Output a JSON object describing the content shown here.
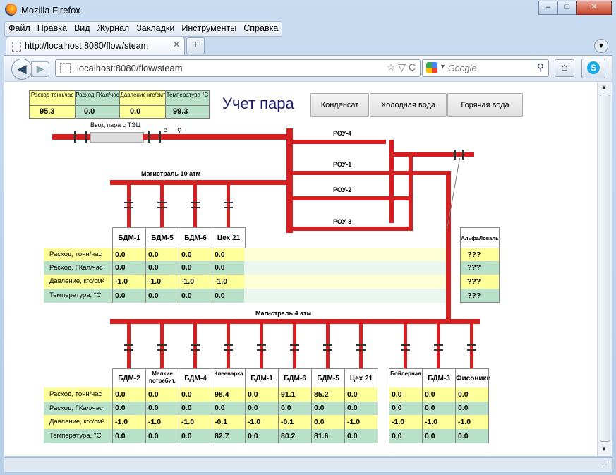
{
  "window": {
    "title": "Mozilla Firefox",
    "min": "–",
    "max": "□",
    "close": "✕"
  },
  "menu": [
    "Файл",
    "Правка",
    "Вид",
    "Журнал",
    "Закладки",
    "Инструменты",
    "Справка"
  ],
  "tab": {
    "title": "http://localhost:8080/flow/steam",
    "close": "✕",
    "new": "+"
  },
  "nav": {
    "back": "◀",
    "forward": "▶",
    "url": "localhost:8080/flow/steam",
    "search_placeholder": "Google",
    "home": "⌂",
    "url_icons": "☆ ▽ C",
    "search_icon": "⚲"
  },
  "page": {
    "title": "Учет пара",
    "buttons": [
      "Конденсат",
      "Холодная вода",
      "Горячая вода"
    ],
    "summary": {
      "headers": [
        "Расход тонн/час",
        "Расход ГКал/час",
        "Давление кгс/см²",
        "Температура °С"
      ],
      "values": [
        "95.3",
        "0.0",
        "0.0",
        "99.3"
      ]
    },
    "labels": {
      "inlet": "Ввод пара с ТЭЦ",
      "main10": "Магистраль 10 атм",
      "main4": "Магистраль 4 атм",
      "rou4": "РОУ-4",
      "rou1": "РОУ-1",
      "rou2": "РОУ-2",
      "rou3": "РОУ-3",
      "alfa": "АльфаЛоваль"
    },
    "row_labels": [
      "Расход, тонн/час",
      "Расход, ГКал/час",
      "Давление, кгс/см²",
      "Температура, °С"
    ],
    "top_consumers": [
      {
        "name": "БДМ-1",
        "values": [
          "0.0",
          "0.0",
          "-1.0",
          "0.0"
        ]
      },
      {
        "name": "БДМ-5",
        "values": [
          "0.0",
          "0.0",
          "-1.0",
          "0.0"
        ]
      },
      {
        "name": "БДМ-6",
        "values": [
          "0.0",
          "0.0",
          "-1.0",
          "0.0"
        ]
      },
      {
        "name": "Цех 21",
        "values": [
          "0.0",
          "0.0",
          "-1.0",
          "0.0"
        ]
      }
    ],
    "alfa_values": [
      "???",
      "???",
      "???",
      "???"
    ],
    "bottom_consumers": [
      {
        "name": "БДМ-2",
        "values": [
          "0.0",
          "0.0",
          "-1.0",
          "0.0"
        ]
      },
      {
        "name": "Мелкие потребит.",
        "values": [
          "0.0",
          "0.0",
          "-1.0",
          "0.0"
        ]
      },
      {
        "name": "БДМ-4",
        "values": [
          "0.0",
          "0.0",
          "-1.0",
          "0.0"
        ]
      },
      {
        "name": "Клееварка",
        "values": [
          "98.4",
          "0.0",
          "-0.1",
          "82.7"
        ]
      },
      {
        "name": "БДМ-1",
        "values": [
          "0.0",
          "0.0",
          "-1.0",
          "0.0"
        ]
      },
      {
        "name": "БДМ-6",
        "values": [
          "91.1",
          "0.0",
          "-0.1",
          "80.2"
        ]
      },
      {
        "name": "БДМ-5",
        "values": [
          "85.2",
          "0.0",
          "0.0",
          "81.6"
        ]
      },
      {
        "name": "Цех 21",
        "values": [
          "0.0",
          "0.0",
          "-1.0",
          "0.0"
        ]
      }
    ],
    "bottom_right_consumers": [
      {
        "name": "Бойлерная",
        "values": [
          "0.0",
          "0.0",
          "-1.0",
          "0.0"
        ]
      },
      {
        "name": "БДМ-3",
        "values": [
          "0.0",
          "0.0",
          "-1.0",
          "0.0"
        ]
      },
      {
        "name": "Фисоники",
        "values": [
          "0.0",
          "0.0",
          "-1.0",
          "0.0"
        ]
      }
    ]
  }
}
